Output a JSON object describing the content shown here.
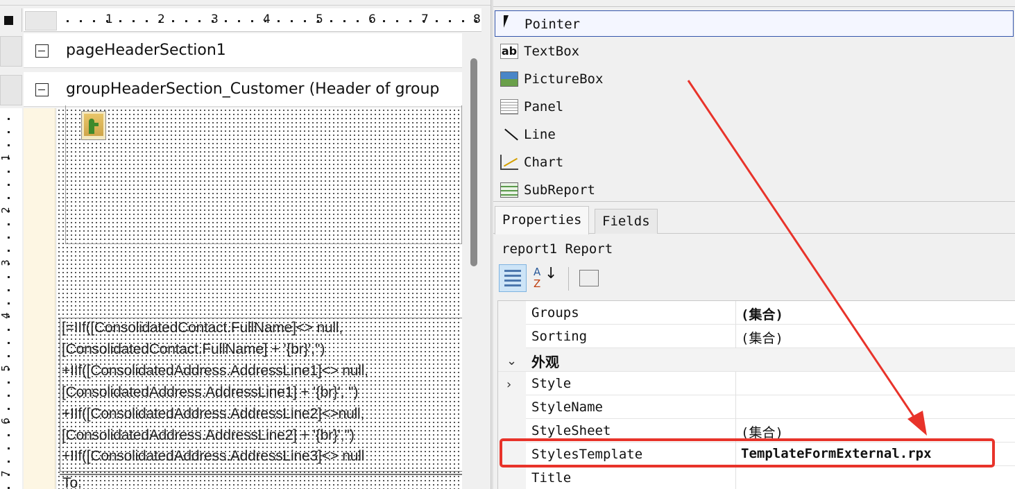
{
  "designer": {
    "ruler_numbers": [
      "1",
      "2",
      "3",
      "4",
      "5",
      "6",
      "7",
      "8"
    ],
    "vertical_ruler_numbers": [
      "1",
      "2",
      "3",
      "4",
      "5",
      "6",
      "7"
    ],
    "sections": {
      "page_header": "pageHeaderSection1",
      "group_header": "groupHeaderSection_Customer (Header of group"
    },
    "textbox_lines": [
      "[=IIf([ConsolidatedContact.FullName]<> null,",
      "[ConsolidatedContact.FullName] + '{br}','')",
      "+IIf([ConsolidatedAddress.AddressLine1]<> null,",
      "[ConsolidatedAddress.AddressLine1] + '{br}', '')",
      "+IIf([ConsolidatedAddress.AddressLine2]<>null,",
      "[ConsolidatedAddress.AddressLine2] + '{br}','')",
      "+IIf([ConsolidatedAddress.AddressLine3]<> null"
    ],
    "to_label": "To:"
  },
  "toolbox": {
    "items": [
      {
        "label": "Pointer",
        "icon": "pointer-icon"
      },
      {
        "label": "TextBox",
        "icon": "textbox-icon",
        "glyph": "ab"
      },
      {
        "label": "PictureBox",
        "icon": "picturebox-icon"
      },
      {
        "label": "Panel",
        "icon": "panel-icon"
      },
      {
        "label": "Line",
        "icon": "line-icon"
      },
      {
        "label": "Chart",
        "icon": "chart-icon"
      },
      {
        "label": "SubReport",
        "icon": "subreport-icon"
      }
    ]
  },
  "properties": {
    "tabs": [
      "Properties",
      "Fields"
    ],
    "object_label": "report1  Report",
    "sort_icons": {
      "a": "A",
      "z": "Z",
      "arrow": "↓"
    },
    "rows": [
      {
        "name": "Groups",
        "value": "(集合)",
        "bold": true
      },
      {
        "name": "Sorting",
        "value": "(集合)",
        "bold": false
      },
      {
        "name": "外观",
        "category": true,
        "chevron": "⌄"
      },
      {
        "name": "Style",
        "value": "",
        "chevron": "›"
      },
      {
        "name": "StyleName",
        "value": ""
      },
      {
        "name": "StyleSheet",
        "value": "(集合)"
      },
      {
        "name": "StylesTemplate",
        "value": "TemplateFormExternal.rpx",
        "bold": true
      },
      {
        "name": "Title",
        "value": ""
      }
    ]
  },
  "annotation_color": "#e8332a"
}
